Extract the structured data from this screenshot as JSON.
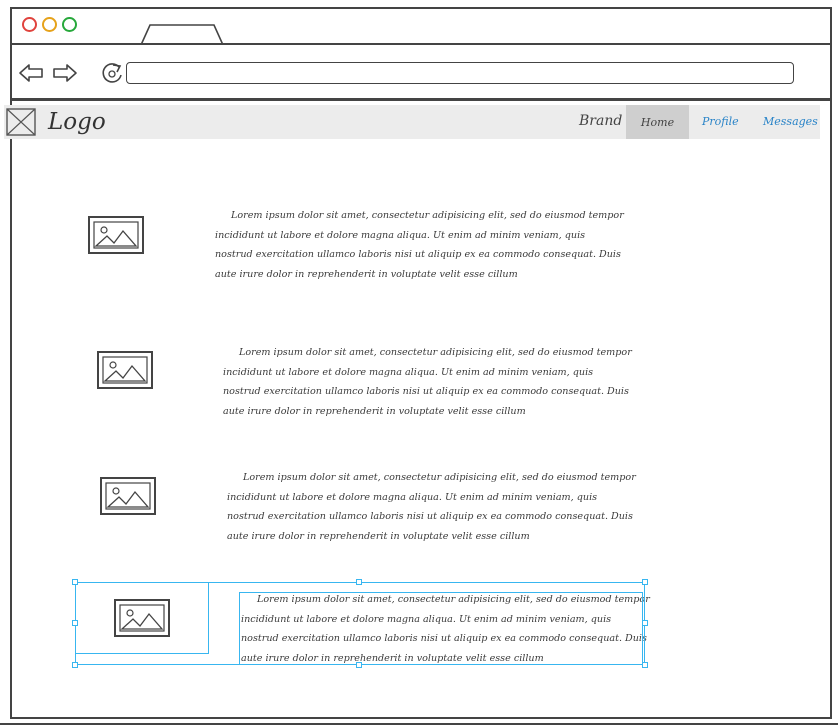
{
  "page": {
    "browser": {
      "window_buttons": [
        "close",
        "minimize",
        "maximize"
      ],
      "colors": {
        "close": "#e0433d",
        "minimize": "#e6a21a",
        "maximize": "#27a83b"
      },
      "address_value": ""
    },
    "header": {
      "logo": "Logo",
      "brand": "Brand",
      "nav": {
        "home": "Home",
        "profile": "Profile",
        "messages": "Messages"
      },
      "colors": {
        "background": "#ececec",
        "active_tab": "#cfcfcf",
        "link": "#2a84c8"
      }
    },
    "items": [
      {
        "text": "Lorem ipsum dolor sit amet, consectetur adipisicing elit, sed do eiusmod tempor incididunt ut labore et dolore magna aliqua. Ut enim ad minim veniam, quis nostrud exercitation ullamco laboris nisi ut aliquip ex ea commodo consequat. Duis aute irure dolor in reprehenderit in voluptate velit esse cillum"
      },
      {
        "text": "Lorem ipsum dolor sit amet, consectetur adipisicing elit, sed do eiusmod tempor incididunt ut labore et dolore magna aliqua. Ut enim ad minim veniam, quis nostrud exercitation ullamco laboris nisi ut aliquip ex ea commodo consequat. Duis aute irure dolor in reprehenderit in voluptate velit esse cillum"
      },
      {
        "text": "Lorem ipsum dolor sit amet, consectetur adipisicing elit, sed do eiusmod tempor incididunt ut labore et dolore magna aliqua. Ut enim ad minim veniam, quis nostrud exercitation ullamco laboris nisi ut aliquip ex ea commodo consequat. Duis aute irure dolor in reprehenderit in voluptate velit esse cillum"
      },
      {
        "text": "Lorem ipsum dolor sit amet, consectetur adipisicing elit, sed do eiusmod tempor incididunt ut labore et dolore magna aliqua. Ut enim ad minim veniam, quis nostrud exercitation ullamco laboris nisi ut aliquip ex ea commodo consequat. Duis aute irure dolor in reprehenderit in voluptate velit esse cillum"
      }
    ],
    "selection_color": "#38b6f0"
  }
}
